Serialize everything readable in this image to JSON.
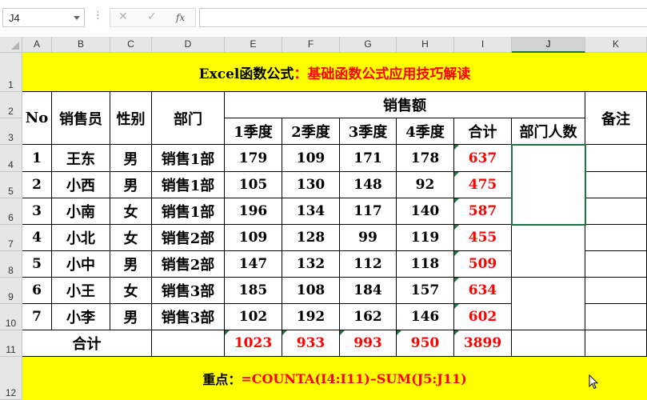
{
  "formula_bar": {
    "name_box": "J4",
    "dots": "⋮",
    "cancel_glyph": "✕",
    "enter_glyph": "✓",
    "fx_label": "fx",
    "formula": ""
  },
  "column_headers": [
    "A",
    "B",
    "C",
    "D",
    "E",
    "F",
    "G",
    "H",
    "I",
    "J",
    "K"
  ],
  "row_headers": [
    "1",
    "2",
    "3",
    "4",
    "5",
    "6",
    "7",
    "8",
    "9",
    "10",
    "11",
    "12"
  ],
  "sheet": {
    "title_black": "Excel函数公式",
    "title_red": "：基础函数公式应用技巧解读",
    "headers": {
      "no": "No",
      "salesperson": "销售员",
      "gender": "性别",
      "department": "部门",
      "sales_amount": "销售额",
      "remarks": "备注",
      "quarters": [
        "1季度",
        "2季度",
        "3季度",
        "4季度"
      ],
      "total": "合计",
      "dept_headcount": "部门人数"
    },
    "rows": [
      {
        "no": "1",
        "name": "王东",
        "gender": "男",
        "dept": "销售1部",
        "q1": "179",
        "q2": "109",
        "q3": "171",
        "q4": "178",
        "total": "637"
      },
      {
        "no": "2",
        "name": "小西",
        "gender": "男",
        "dept": "销售1部",
        "q1": "105",
        "q2": "130",
        "q3": "148",
        "q4": "92",
        "total": "475"
      },
      {
        "no": "3",
        "name": "小南",
        "gender": "女",
        "dept": "销售1部",
        "q1": "196",
        "q2": "134",
        "q3": "117",
        "q4": "140",
        "total": "587"
      },
      {
        "no": "4",
        "name": "小北",
        "gender": "女",
        "dept": "销售2部",
        "q1": "109",
        "q2": "128",
        "q3": "99",
        "q4": "119",
        "total": "455"
      },
      {
        "no": "5",
        "name": "小中",
        "gender": "男",
        "dept": "销售2部",
        "q1": "147",
        "q2": "132",
        "q3": "112",
        "q4": "118",
        "total": "509"
      },
      {
        "no": "6",
        "name": "小王",
        "gender": "女",
        "dept": "销售3部",
        "q1": "185",
        "q2": "108",
        "q3": "184",
        "q4": "157",
        "total": "634"
      },
      {
        "no": "7",
        "name": "小李",
        "gender": "男",
        "dept": "销售3部",
        "q1": "102",
        "q2": "192",
        "q3": "162",
        "q4": "146",
        "total": "602"
      }
    ],
    "totals_row": {
      "label": "合计",
      "q1": "1023",
      "q2": "933",
      "q3": "993",
      "q4": "950",
      "total": "3899"
    },
    "footer_black": "重点：",
    "footer_red": "=COUNTA(I4:I11)–SUM(J5:J11)"
  },
  "colors": {
    "banner_bg": "#ffff00",
    "accent_red": "#ff0000",
    "excel_green": "#217346"
  }
}
